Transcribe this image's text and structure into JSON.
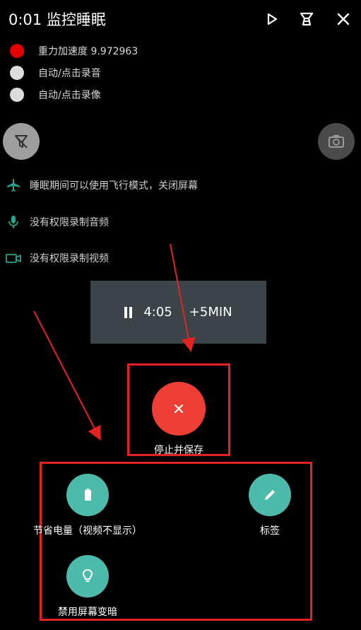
{
  "header": {
    "title": "0:01 监控睡眠",
    "play_icon": "play-icon",
    "filter_icon": "filter-icon",
    "close_icon": "close-icon"
  },
  "status": [
    {
      "label": "重力加速度 9.972963",
      "color": "#e50000"
    },
    {
      "label": "自动/点击录音",
      "color": "#dcdcdc"
    },
    {
      "label": "自动/点击录像",
      "color": "#dcdcdc"
    }
  ],
  "side_buttons": {
    "left_icon": "filter-off-icon",
    "right_icon": "camera-switch-icon"
  },
  "info": [
    {
      "text": "睡眠期间可以使用飞行模式，关闭屏幕",
      "icon": "airplane-icon",
      "color": "#2aa18c"
    },
    {
      "text": "没有权限录制音频",
      "icon": "mic-icon",
      "color": "#2aa18c"
    },
    {
      "text": "没有权限录制视频",
      "icon": "video-icon",
      "color": "#2aa18c"
    }
  ],
  "timer": {
    "time": "4:05",
    "extend_label": "+5MIN"
  },
  "stop": {
    "label": "停止并保存",
    "color": "#ef3f35"
  },
  "options": [
    {
      "label": "节省电量（视频不显示）",
      "icon": "battery-icon"
    },
    {
      "label": "标签",
      "icon": "pencil-icon"
    },
    {
      "label": "禁用屏幕变暗",
      "icon": "lightbulb-icon"
    }
  ],
  "colors": {
    "accent_teal": "#4dbbac",
    "annotation_red": "#e52222",
    "timer_bg": "#3b4549"
  }
}
